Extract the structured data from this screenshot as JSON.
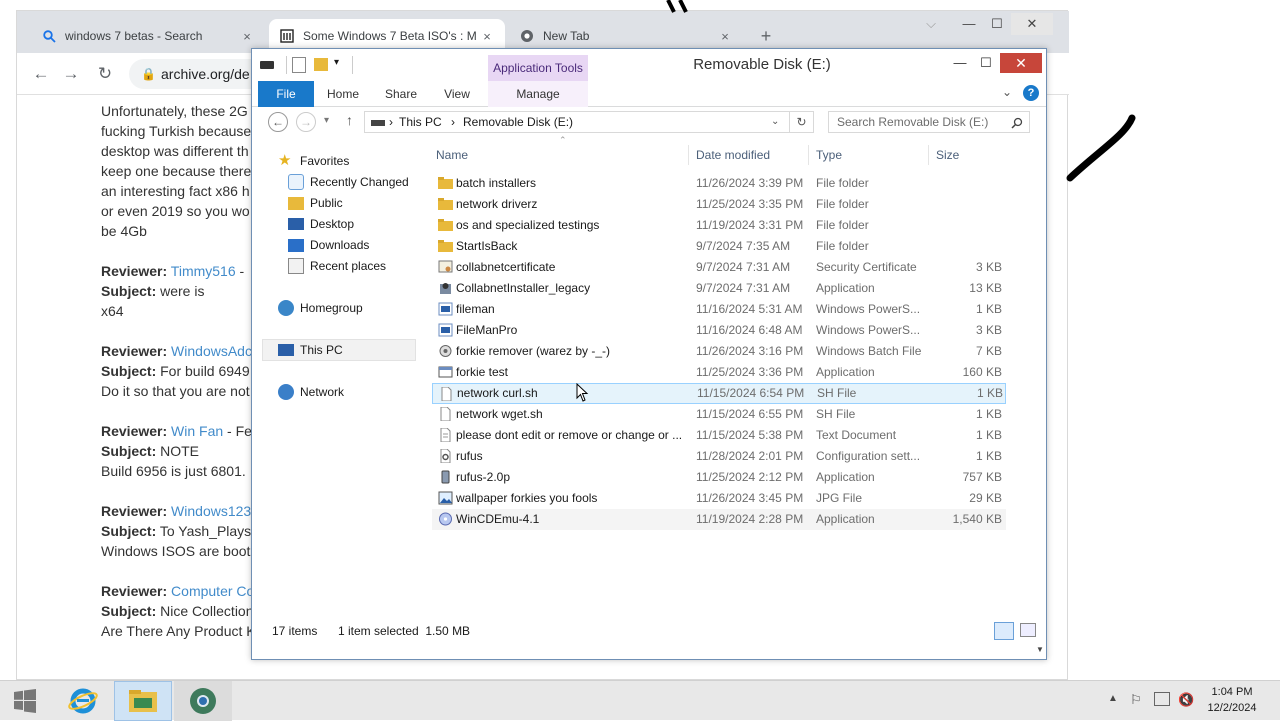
{
  "browser": {
    "tabs": [
      {
        "title": "windows 7 betas - Search",
        "close": "×"
      },
      {
        "title": "Some Windows 7 Beta ISO's : M",
        "close": "×"
      },
      {
        "title": "New Tab",
        "close": "×"
      }
    ],
    "new_tab": "+",
    "url": "archive.org/de",
    "window_controls": {
      "dropdown": "⌵",
      "minimize": "—",
      "maximize": "☐",
      "close": "✕"
    },
    "page_text": {
      "intro": "Unfortunately, these 2G",
      "intro2": "fucking Turkish because",
      "intro3": "desktop was different th",
      "intro4": "keep one because there",
      "intro5": "an interesting fact x86 h",
      "intro6": "or even 2019 so you wo",
      "intro7": "be 4Gb",
      "reviews": [
        {
          "reviewer_label": "Reviewer:",
          "reviewer": "Timmy516",
          "reviewer_suffix": " -",
          "subject_label": "Subject:",
          "subject": " were is",
          "body": "x64"
        },
        {
          "reviewer_label": "Reviewer:",
          "reviewer": "WindowsAdc",
          "reviewer_suffix": "",
          "subject_label": "Subject:",
          "subject": " For build 6949",
          "body": "Do it so that you are not"
        },
        {
          "reviewer_label": "Reviewer:",
          "reviewer": "Win Fan",
          "reviewer_suffix": " - Fe",
          "subject_label": "Subject:",
          "subject": " NOTE",
          "body": "Build 6956 is just 6801."
        },
        {
          "reviewer_label": "Reviewer:",
          "reviewer": "Windows123",
          "reviewer_suffix": "",
          "subject_label": "Subject:",
          "subject": " To Yash_Plays",
          "body": "Windows ISOS are boot"
        },
        {
          "reviewer_label": "Reviewer:",
          "reviewer": "Computer Co",
          "reviewer_suffix": "",
          "subject_label": "Subject:",
          "subject": " Nice Collection",
          "body": "Are There Any Product K"
        }
      ]
    }
  },
  "explorer": {
    "title": "Removable Disk (E:)",
    "context_tab": "Application Tools",
    "ribbon_tabs": [
      "File",
      "Home",
      "Share",
      "View",
      "Manage"
    ],
    "controls": {
      "minimize": "—",
      "maximize": "☐",
      "close": "✕",
      "help": "?"
    },
    "address": {
      "root": "This PC",
      "sep": "›",
      "current": "Removable Disk (E:)"
    },
    "search_placeholder": "Search Removable Disk (E:)",
    "nav": {
      "favorites": "Favorites",
      "favorites_items": [
        "Recently Changed",
        "Public",
        "Desktop",
        "Downloads",
        "Recent places"
      ],
      "homegroup": "Homegroup",
      "this_pc": "This PC",
      "network": "Network"
    },
    "columns": {
      "name": "Name",
      "date": "Date modified",
      "type": "Type",
      "size": "Size"
    },
    "files": [
      {
        "name": "batch installers",
        "date": "11/26/2024 3:39 PM",
        "type": "File folder",
        "size": "",
        "icon": "folder-icon"
      },
      {
        "name": "network driverz",
        "date": "11/25/2024 3:35 PM",
        "type": "File folder",
        "size": "",
        "icon": "folder-icon"
      },
      {
        "name": "os and specialized testings",
        "date": "11/19/2024 3:31 PM",
        "type": "File folder",
        "size": "",
        "icon": "folder-icon"
      },
      {
        "name": "StartIsBack",
        "date": "9/7/2024 7:35 AM",
        "type": "File folder",
        "size": "",
        "icon": "folder-icon"
      },
      {
        "name": "collabnetcertificate",
        "date": "9/7/2024 7:31 AM",
        "type": "Security Certificate",
        "size": "3 KB",
        "icon": "certificate-icon"
      },
      {
        "name": "CollabnetInstaller_legacy",
        "date": "9/7/2024 7:31 AM",
        "type": "Application",
        "size": "13 KB",
        "icon": "installer-icon"
      },
      {
        "name": "fileman",
        "date": "11/16/2024 5:31 AM",
        "type": "Windows PowerS...",
        "size": "1 KB",
        "icon": "powershell-icon"
      },
      {
        "name": "FileManPro",
        "date": "11/16/2024 6:48 AM",
        "type": "Windows PowerS...",
        "size": "3 KB",
        "icon": "powershell-icon"
      },
      {
        "name": "forkie remover  (warez by -_-)",
        "date": "11/26/2024 3:16 PM",
        "type": "Windows Batch File",
        "size": "7 KB",
        "icon": "batch-icon"
      },
      {
        "name": "forkie test",
        "date": "11/25/2024 3:36 PM",
        "type": "Application",
        "size": "160 KB",
        "icon": "application-icon"
      },
      {
        "name": "network curl.sh",
        "date": "11/15/2024 6:54 PM",
        "type": "SH File",
        "size": "1 KB",
        "icon": "document-icon"
      },
      {
        "name": "network wget.sh",
        "date": "11/15/2024 6:55 PM",
        "type": "SH File",
        "size": "1 KB",
        "icon": "document-icon"
      },
      {
        "name": "please dont edit or remove or change or ...",
        "date": "11/15/2024 5:38 PM",
        "type": "Text Document",
        "size": "1 KB",
        "icon": "text-document-icon"
      },
      {
        "name": "rufus",
        "date": "11/28/2024 2:01 PM",
        "type": "Configuration sett...",
        "size": "1 KB",
        "icon": "config-icon"
      },
      {
        "name": "rufus-2.0p",
        "date": "11/25/2024 2:12 PM",
        "type": "Application",
        "size": "757 KB",
        "icon": "usb-app-icon"
      },
      {
        "name": "wallpaper forkies you fools",
        "date": "11/26/2024 3:45 PM",
        "type": "JPG File",
        "size": "29 KB",
        "icon": "image-icon"
      },
      {
        "name": "WinCDEmu-4.1",
        "date": "11/19/2024 2:28 PM",
        "type": "Application",
        "size": "1,540 KB",
        "icon": "disc-app-icon"
      }
    ],
    "selected_index": 10,
    "status": {
      "count": "17 items",
      "selection": "1 item selected  1.50 MB"
    }
  },
  "taskbar": {
    "clock_time": "1:04 PM",
    "clock_date": "12/2/2024"
  },
  "colors": {
    "accent": "#1979ca",
    "context_tab": "#e8d7f4",
    "close_red": "#c7463a",
    "selection": "#e5f3fb",
    "link": "#428bca"
  }
}
